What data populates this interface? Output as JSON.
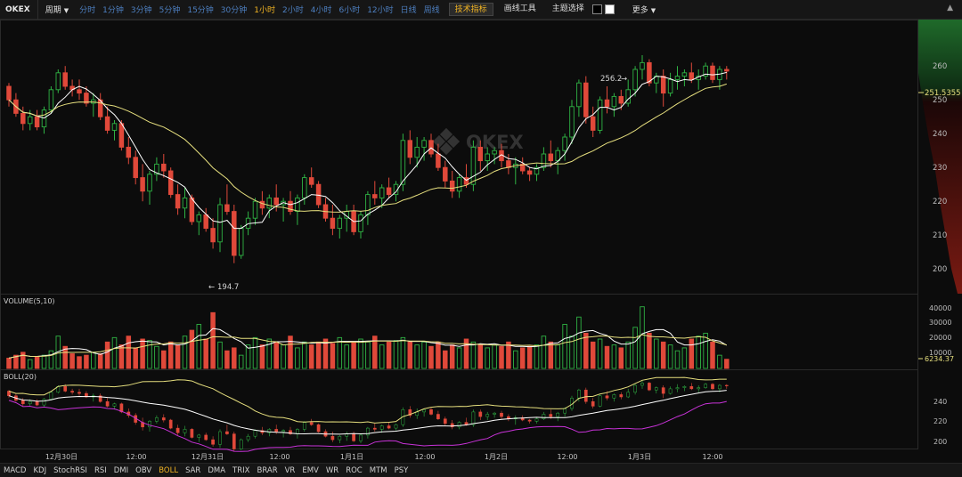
{
  "toolbar": {
    "symbol": "OKEX",
    "period_dropdown": "周期",
    "periods": [
      "分时",
      "1分钟",
      "3分钟",
      "5分钟",
      "15分钟",
      "30分钟",
      "1小时",
      "2小时",
      "4小时",
      "6小时",
      "12小时",
      "日线",
      "周线"
    ],
    "active_period": "1小时",
    "tech_indicators": "技术指标",
    "drawing_tools": "画线工具",
    "theme_select": "主题选择",
    "more": "更多",
    "theme_colors": [
      "#000000",
      "#ffffff"
    ]
  },
  "price_panel": {
    "high_label": "256.2",
    "low_label": "194.7",
    "current_price": "251.5355",
    "watermark": "OKEX",
    "y_ticks": [
      "260",
      "250",
      "240",
      "230",
      "220",
      "210",
      "200"
    ]
  },
  "volume_panel": {
    "title": "VOLUME(5,10)",
    "y_ticks": [
      "40000",
      "30000",
      "20000",
      "10000"
    ],
    "current_value": "6234.37"
  },
  "boll_panel": {
    "title": "BOLL(20)",
    "y_ticks": [
      "240",
      "220",
      "200"
    ]
  },
  "x_axis_labels": [
    "12月30日",
    "12:00",
    "12月31日",
    "12:00",
    "1月1日",
    "12:00",
    "1月2日",
    "12:00",
    "1月3日",
    "12:00"
  ],
  "indicator_tabs": [
    "MACD",
    "KDJ",
    "StochRSI",
    "RSI",
    "DMI",
    "OBV",
    "BOLL",
    "SAR",
    "DMA",
    "TRIX",
    "BRAR",
    "VR",
    "EMV",
    "WR",
    "ROC",
    "MTM",
    "PSY"
  ],
  "active_indicator": "BOLL",
  "colors": {
    "up": "#2fb344",
    "down": "#e0493a",
    "ma_fast": "#ffffff",
    "ma_slow": "#e6df7e",
    "boll_lower": "#c832d8",
    "accent": "#f0b323"
  },
  "chart_data": {
    "type": "candlestick",
    "ylim": [
      193,
      268
    ],
    "candles": [
      [
        247,
        248,
        241,
        243
      ],
      [
        243,
        245,
        238,
        239
      ],
      [
        239,
        241,
        234,
        236
      ],
      [
        236,
        240,
        234,
        238
      ],
      [
        238,
        240,
        234,
        235
      ],
      [
        235,
        241,
        233,
        240
      ],
      [
        240,
        247,
        239,
        246
      ],
      [
        246,
        252,
        245,
        251
      ],
      [
        251,
        253,
        246,
        247
      ],
      [
        247,
        249,
        244,
        246
      ],
      [
        246,
        249,
        243,
        245
      ],
      [
        245,
        247,
        241,
        242
      ],
      [
        242,
        245,
        238,
        243
      ],
      [
        243,
        245,
        237,
        238
      ],
      [
        238,
        241,
        233,
        234
      ],
      [
        234,
        237,
        231,
        236
      ],
      [
        236,
        237,
        228,
        229
      ],
      [
        229,
        232,
        224,
        226
      ],
      [
        226,
        228,
        218,
        220
      ],
      [
        220,
        224,
        213,
        216
      ],
      [
        216,
        222,
        212,
        221
      ],
      [
        221,
        226,
        219,
        224
      ],
      [
        224,
        227,
        220,
        222
      ],
      [
        222,
        223,
        214,
        215
      ],
      [
        215,
        218,
        209,
        211
      ],
      [
        211,
        217,
        208,
        214
      ],
      [
        214,
        215,
        206,
        207
      ],
      [
        207,
        210,
        203,
        209
      ],
      [
        209,
        211,
        204,
        205
      ],
      [
        205,
        208,
        199,
        201
      ],
      [
        201,
        214,
        198,
        212
      ],
      [
        212,
        218,
        209,
        210
      ],
      [
        210,
        212,
        194.7,
        197
      ],
      [
        197,
        206,
        196,
        205
      ],
      [
        205,
        210,
        203,
        208
      ],
      [
        208,
        214,
        206,
        213
      ],
      [
        213,
        216,
        209,
        211
      ],
      [
        211,
        215,
        208,
        214
      ],
      [
        214,
        218,
        210,
        212
      ],
      [
        212,
        214,
        207,
        213
      ],
      [
        213,
        216,
        209,
        210
      ],
      [
        210,
        215,
        206,
        214
      ],
      [
        214,
        221,
        212,
        220
      ],
      [
        220,
        223,
        217,
        218
      ],
      [
        218,
        219,
        211,
        212
      ],
      [
        212,
        214,
        207,
        208
      ],
      [
        208,
        212,
        203,
        205
      ],
      [
        205,
        209,
        202,
        208
      ],
      [
        208,
        212,
        204,
        210
      ],
      [
        210,
        212,
        203,
        204
      ],
      [
        204,
        210,
        202,
        209
      ],
      [
        209,
        216,
        206,
        215
      ],
      [
        215,
        219,
        212,
        214
      ],
      [
        214,
        218,
        211,
        217
      ],
      [
        217,
        220,
        214,
        215
      ],
      [
        215,
        219,
        213,
        218
      ],
      [
        218,
        233,
        216,
        231
      ],
      [
        231,
        234,
        224,
        226
      ],
      [
        226,
        232,
        223,
        229
      ],
      [
        229,
        232,
        225,
        231
      ],
      [
        231,
        233,
        226,
        227
      ],
      [
        227,
        230,
        222,
        223
      ],
      [
        223,
        225,
        217,
        219
      ],
      [
        219,
        222,
        214,
        216
      ],
      [
        216,
        221,
        214,
        220
      ],
      [
        220,
        224,
        217,
        218
      ],
      [
        218,
        231,
        216,
        229
      ],
      [
        229,
        231,
        222,
        225
      ],
      [
        225,
        229,
        222,
        227
      ],
      [
        227,
        229,
        224,
        228
      ],
      [
        228,
        230,
        223,
        225
      ],
      [
        225,
        227,
        221,
        223
      ],
      [
        223,
        226,
        218,
        224
      ],
      [
        224,
        226,
        221,
        222
      ],
      [
        222,
        223,
        219,
        221
      ],
      [
        221,
        224,
        219,
        223
      ],
      [
        223,
        229,
        222,
        227
      ],
      [
        227,
        231,
        223,
        225
      ],
      [
        225,
        229,
        221,
        228
      ],
      [
        228,
        233,
        225,
        232
      ],
      [
        232,
        243,
        230,
        241
      ],
      [
        241,
        249,
        238,
        248
      ],
      [
        248,
        250,
        236,
        238
      ],
      [
        238,
        241,
        232,
        234
      ],
      [
        234,
        244,
        233,
        243
      ],
      [
        243,
        247,
        239,
        241
      ],
      [
        241,
        245,
        238,
        244
      ],
      [
        244,
        246,
        240,
        242
      ],
      [
        242,
        249,
        241,
        246
      ],
      [
        246,
        253,
        244,
        252
      ],
      [
        252,
        256.2,
        249,
        254
      ],
      [
        254,
        255,
        247,
        248
      ],
      [
        248,
        251,
        245,
        250
      ],
      [
        250,
        252,
        241,
        245
      ],
      [
        245,
        251,
        244,
        249
      ],
      [
        249,
        253,
        246,
        250
      ],
      [
        250,
        252,
        247,
        251
      ],
      [
        251,
        254,
        248,
        249
      ],
      [
        249,
        252,
        246,
        250
      ],
      [
        250,
        254,
        249,
        253
      ],
      [
        253,
        254,
        248,
        249
      ],
      [
        249,
        253,
        246,
        252
      ],
      [
        252,
        253,
        249,
        251.5
      ]
    ],
    "volume": [
      7000,
      9000,
      11000,
      6000,
      8000,
      9000,
      12000,
      22000,
      15000,
      10000,
      8000,
      9000,
      11000,
      10000,
      18000,
      21000,
      16000,
      22000,
      14000,
      20000,
      19000,
      15000,
      12000,
      18000,
      16000,
      22000,
      26000,
      30000,
      20000,
      38000,
      18000,
      12000,
      14000,
      9000,
      16000,
      21000,
      16000,
      20000,
      18000,
      16000,
      22000,
      14000,
      18000,
      16000,
      18000,
      20000,
      17000,
      21000,
      16000,
      18000,
      20000,
      18000,
      22000,
      16000,
      18000,
      19000,
      21000,
      18000,
      16000,
      18000,
      15000,
      18000,
      12000,
      16000,
      14000,
      20000,
      18000,
      16000,
      14000,
      16000,
      15000,
      18000,
      12000,
      14000,
      15000,
      16000,
      22000,
      18000,
      16000,
      30000,
      22000,
      35000,
      24000,
      18000,
      20000,
      15000,
      16000,
      14000,
      18000,
      28000,
      42000,
      24000,
      20000,
      18000,
      16000,
      12000,
      14000,
      20000,
      22000,
      24000,
      18000,
      9000,
      6234.37
    ]
  }
}
